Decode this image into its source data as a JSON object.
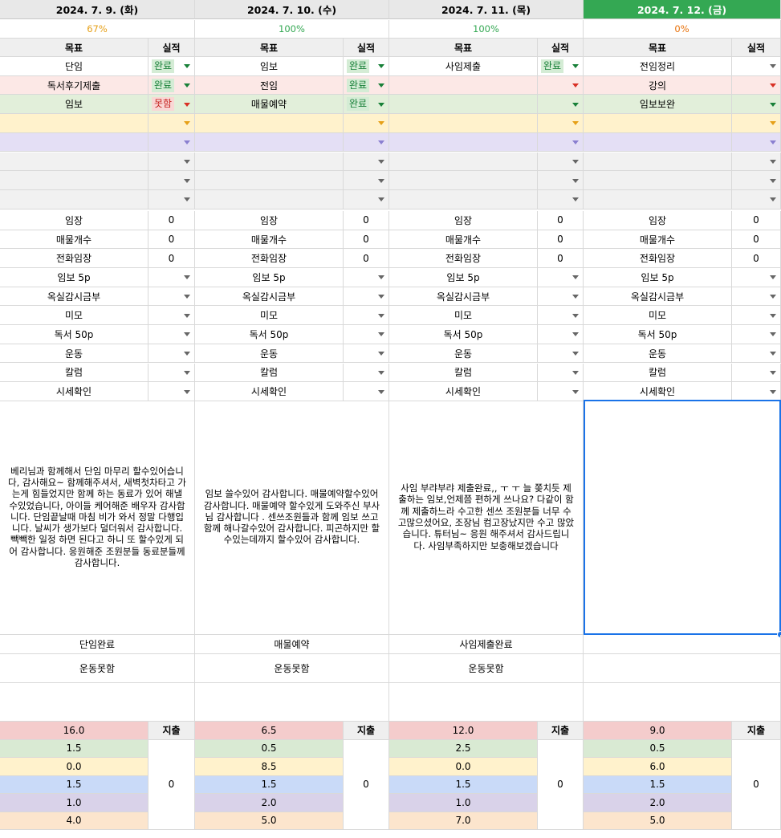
{
  "labels": {
    "goal": "목표",
    "result": "실적",
    "expense": "지출"
  },
  "days": [
    {
      "date": "2024. 7. 9. (화)",
      "today": false,
      "percent": "67%",
      "percent_color": "#e6a018",
      "tasks": [
        {
          "goal": "단임",
          "result": "완료",
          "status": "ok"
        },
        {
          "goal": "독서후기제출",
          "result": "완료",
          "status": "ok"
        },
        {
          "goal": "임보",
          "result": "못함",
          "status": "bad"
        },
        {
          "goal": "",
          "result": "",
          "status": ""
        },
        {
          "goal": "",
          "result": "",
          "status": ""
        },
        {
          "goal": "",
          "result": "",
          "status": ""
        },
        {
          "goal": "",
          "result": "",
          "status": ""
        },
        {
          "goal": "",
          "result": "",
          "status": ""
        }
      ],
      "metrics": [
        {
          "label": "임장",
          "value": "0"
        },
        {
          "label": "매물개수",
          "value": "0"
        },
        {
          "label": "전화임장",
          "value": "0"
        }
      ],
      "habits": [
        "임보 5p",
        "옥실감시금부",
        "미모",
        "독서 50p",
        "운동",
        "칼럼",
        "시세확인"
      ],
      "diary": "베리님과 함께해서 단임 마무리 할수있어습니다, 감사해요~ 함께해주셔서, 새벽첫차타고 가는게 힘들었지만 함께 하는 동료가 있어 해낼수있었습니다, 아이들 케어해준 배우자 감사합니다. 단임끝날때 마침 비가 와서 정말 다행입니다. 날씨가 생가보다 덜더워서 감사합니다. 빽빽한 일정 하면 된다고 하니 또 할수있게 되어 감사합니다. 응원해준 조원분들 동료분들께 감사합니다.",
      "summary1": "단임완료",
      "summary2": "운동못함",
      "budget": [
        "16.0",
        "1.5",
        "0.0",
        "1.5",
        "1.0",
        "4.0"
      ],
      "expense": "0"
    },
    {
      "date": "2024. 7. 10. (수)",
      "today": false,
      "percent": "100%",
      "percent_color": "#34a853",
      "tasks": [
        {
          "goal": "임보",
          "result": "완료",
          "status": "ok"
        },
        {
          "goal": "전임",
          "result": "완료",
          "status": "ok"
        },
        {
          "goal": "매물예약",
          "result": "완료",
          "status": "ok"
        },
        {
          "goal": "",
          "result": "",
          "status": ""
        },
        {
          "goal": "",
          "result": "",
          "status": ""
        },
        {
          "goal": "",
          "result": "",
          "status": ""
        },
        {
          "goal": "",
          "result": "",
          "status": ""
        },
        {
          "goal": "",
          "result": "",
          "status": ""
        }
      ],
      "metrics": [
        {
          "label": "임장",
          "value": "0"
        },
        {
          "label": "매물개수",
          "value": "0"
        },
        {
          "label": "전화임장",
          "value": "0"
        }
      ],
      "habits": [
        "임보 5p",
        "옥실감시금부",
        "미모",
        "독서 50p",
        "운동",
        "칼럼",
        "시세확인"
      ],
      "diary": "임보 쓸수있어 감사합니다. 매물예약할수있어 감사합니다. 매물예약 할수있게 도와주신 부사님 감사합니다 . 센쓰조원들과 함께 임보 쓰고 함께 해나갈수있어 감사합니다. 피곤하지만 할수있는데까지 할수있어 감사합니다.",
      "summary1": "매물예약",
      "summary2": "운동못함",
      "budget": [
        "6.5",
        "0.5",
        "8.5",
        "1.5",
        "2.0",
        "5.0"
      ],
      "expense": "0"
    },
    {
      "date": "2024. 7. 11. (목)",
      "today": false,
      "percent": "100%",
      "percent_color": "#34a853",
      "tasks": [
        {
          "goal": "사임제출",
          "result": "완료",
          "status": "ok"
        },
        {
          "goal": "",
          "result": "",
          "status": ""
        },
        {
          "goal": "",
          "result": "",
          "status": ""
        },
        {
          "goal": "",
          "result": "",
          "status": ""
        },
        {
          "goal": "",
          "result": "",
          "status": ""
        },
        {
          "goal": "",
          "result": "",
          "status": ""
        },
        {
          "goal": "",
          "result": "",
          "status": ""
        },
        {
          "goal": "",
          "result": "",
          "status": ""
        }
      ],
      "metrics": [
        {
          "label": "임장",
          "value": "0"
        },
        {
          "label": "매물개수",
          "value": "0"
        },
        {
          "label": "전화임장",
          "value": "0"
        }
      ],
      "habits": [
        "임보 5p",
        "옥실감시금부",
        "미모",
        "독서 50p",
        "운동",
        "칼럼",
        "시세확인"
      ],
      "diary": "사임 부랴부랴 제출완료,, ㅜ ㅜ 늘 쫒치듯 제출하는 임보,언제쯤 편하게 쓰나요? 다같이 함께 제출하느라 수고한 센쓰 조원분들 너무 수고많으셨어요, 조장님 컴고장났지만 수고 많았습니다. 튜터님~ 응원 해주셔서 감사드립니다. 사임부족하지만 보충해보겠습니다",
      "summary1": "사임제출완료",
      "summary2": "운동못함",
      "budget": [
        "12.0",
        "2.5",
        "0.0",
        "1.5",
        "1.0",
        "7.0"
      ],
      "expense": "0"
    },
    {
      "date": "2024. 7. 12. (금)",
      "today": true,
      "percent": "0%",
      "percent_color": "#e8710a",
      "tasks": [
        {
          "goal": "전임정리",
          "result": "",
          "status": ""
        },
        {
          "goal": "강의",
          "result": "",
          "status": ""
        },
        {
          "goal": "임보보완",
          "result": "",
          "status": ""
        },
        {
          "goal": "",
          "result": "",
          "status": ""
        },
        {
          "goal": "",
          "result": "",
          "status": ""
        },
        {
          "goal": "",
          "result": "",
          "status": ""
        },
        {
          "goal": "",
          "result": "",
          "status": ""
        },
        {
          "goal": "",
          "result": "",
          "status": ""
        }
      ],
      "metrics": [
        {
          "label": "임장",
          "value": "0"
        },
        {
          "label": "매물개수",
          "value": "0"
        },
        {
          "label": "전화임장",
          "value": "0"
        }
      ],
      "habits": [
        "임보 5p",
        "옥실감시금부",
        "미모",
        "독서 50p",
        "운동",
        "칼럼",
        "시세확인"
      ],
      "diary": "",
      "summary1": "",
      "summary2": "",
      "budget": [
        "9.0",
        "0.5",
        "6.0",
        "1.5",
        "2.0",
        "5.0"
      ],
      "expense": "0"
    }
  ],
  "colors": {
    "task_rows": [
      "#ffffff",
      "#fce8e6",
      "#e2efda",
      "#fff2cc",
      "#e4dff5",
      "#f1f1f1",
      "#f1f1f1",
      "#f1f1f1"
    ],
    "task_arrows": [
      "",
      "red",
      "green",
      "amber",
      "violet",
      "",
      "",
      ""
    ],
    "budget_rows": [
      "#f4cccc",
      "#d9ead3",
      "#fff2cc",
      "#c9daf8",
      "#d9d2e9",
      "#fce5cd"
    ],
    "today_header": "#34a853",
    "selection": "#1a73e8"
  }
}
